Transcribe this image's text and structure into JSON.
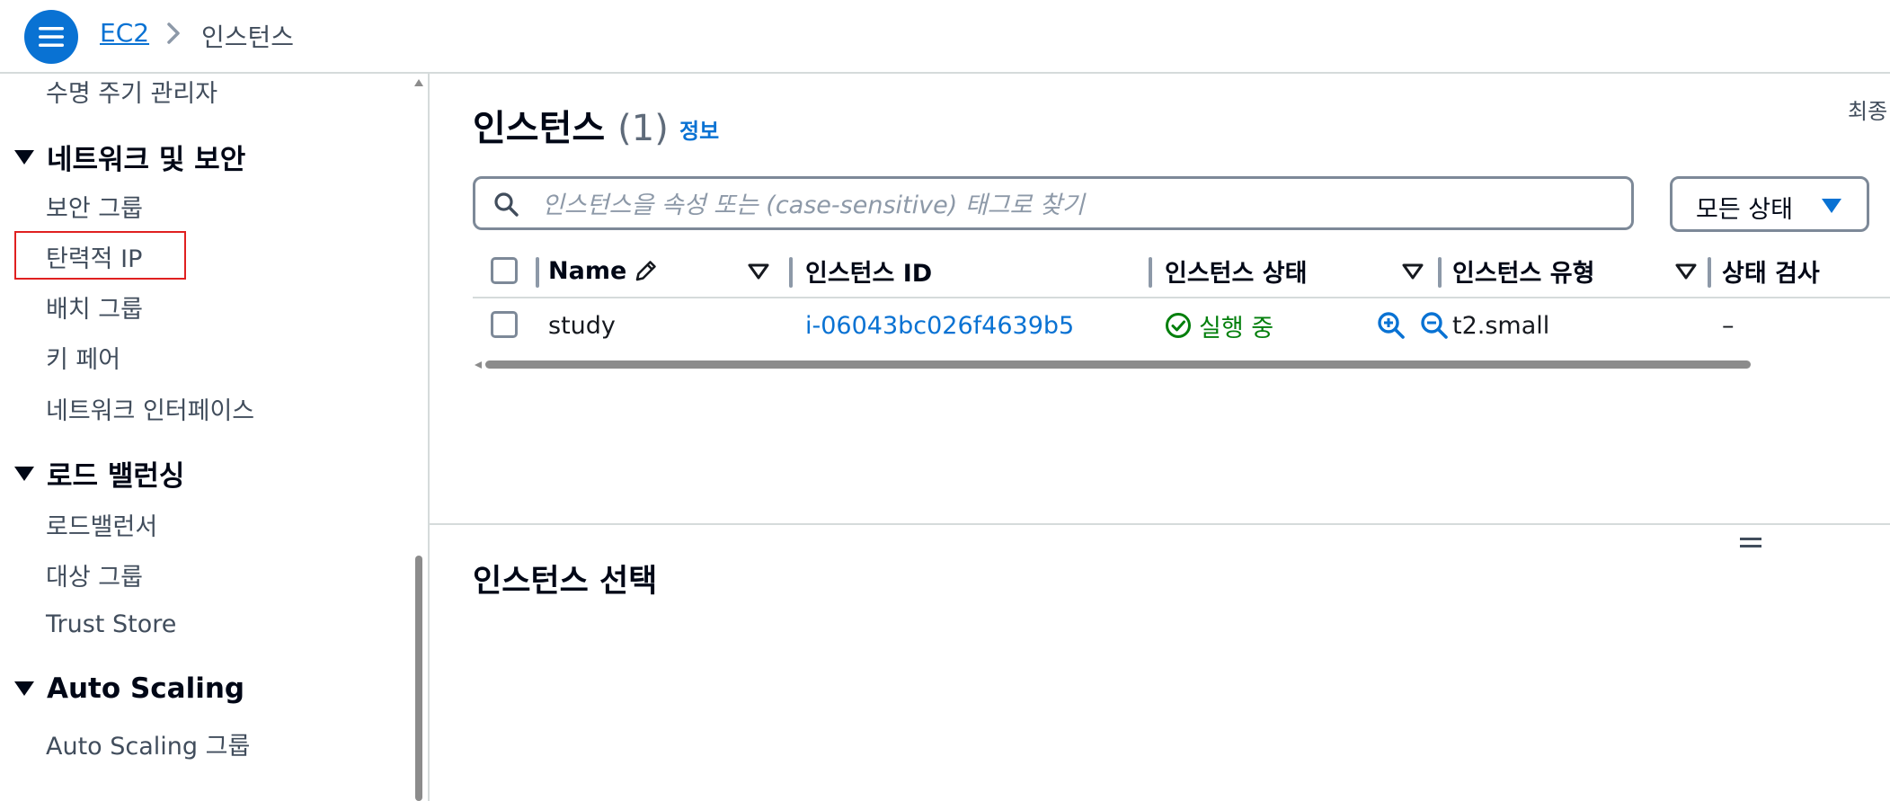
{
  "breadcrumb": {
    "service": "EC2",
    "current": "인스턴스"
  },
  "sidebar": {
    "items": [
      {
        "label": "수명 주기 관리자"
      },
      {
        "label": "네트워크 및 보안",
        "section": true
      },
      {
        "label": "보안 그룹"
      },
      {
        "label": "탄력적 IP",
        "highlighted": true
      },
      {
        "label": "배치 그룹"
      },
      {
        "label": "키 페어"
      },
      {
        "label": "네트워크 인터페이스"
      },
      {
        "label": "로드 밸런싱",
        "section": true
      },
      {
        "label": "로드밸런서"
      },
      {
        "label": "대상 그룹"
      },
      {
        "label": "Trust Store"
      },
      {
        "label": "Auto Scaling",
        "section": true
      },
      {
        "label": "Auto Scaling 그룹"
      }
    ]
  },
  "main": {
    "title": "인스턴스",
    "count": "(1)",
    "info_link": "정보",
    "last_updated": "최종",
    "search": {
      "placeholder": "인스턴스을 속성 또는 (case-sensitive) 태그로 찾기",
      "value": ""
    },
    "state_filter": {
      "label": "모든 상태"
    },
    "table": {
      "columns": [
        "Name",
        "인스턴스 ID",
        "인스턴스 상태",
        "인스턴스 유형",
        "상태 검사"
      ],
      "rows": [
        {
          "name": "study",
          "instance_id": "i-06043bc026f4639b5",
          "state": "실행 중",
          "type": "t2.small",
          "status_check": "–"
        }
      ]
    },
    "selection_title": "인스턴스 선택"
  },
  "colors": {
    "accent": "#0972d3",
    "success": "#037f0c",
    "highlight_border": "#e02020",
    "border": "#7d8998"
  }
}
